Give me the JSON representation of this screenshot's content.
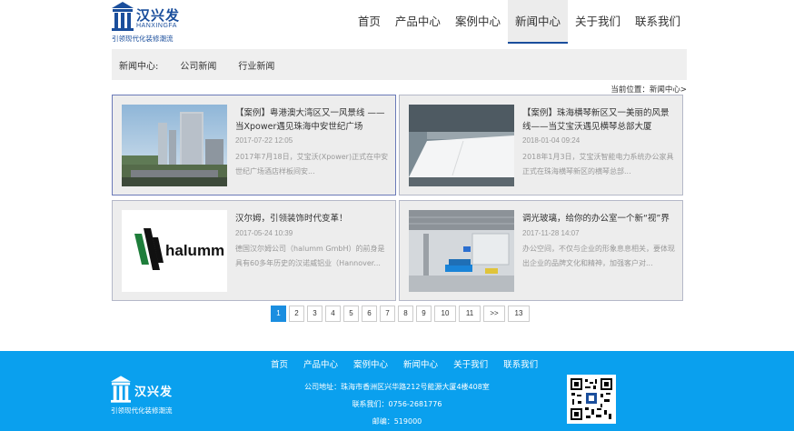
{
  "brand": {
    "name_cn": "汉兴发",
    "name_en": "HANXINGFA",
    "tagline": "引领现代化装修潮流",
    "color": "#1a4e9c"
  },
  "nav": {
    "items": [
      "首页",
      "产品中心",
      "案例中心",
      "新闻中心",
      "关于我们",
      "联系我们"
    ],
    "active": "新闻中心"
  },
  "subbar": {
    "label": "新闻中心:",
    "links": [
      "公司新闻",
      "行业新闻"
    ]
  },
  "breadcrumb": "当前位置：新闻中心>",
  "news": [
    {
      "title": "【案例】粤港澳大湾区又一风景线 ——当Xpower遇见珠海中安世纪广场",
      "date": "2017-07-22 12:05",
      "desc": "2017年7月18日，艾宝沃(Xpower)正式在中安世纪广场酒店样板间安...",
      "image": "building-photo"
    },
    {
      "title": "【案例】珠海横琴新区又一美丽的风景线——当艾宝沃遇见横琴总部大厦",
      "date": "2018-01-04 09:24",
      "desc": "2018年1月3日，艾宝沃智能电力系统办公家具正式在珠海横琴新区的横琴总部...",
      "image": "meeting-table-photo"
    },
    {
      "title": "汉尔姆，引领装饰时代变革！",
      "date": "2017-05-24 10:39",
      "desc": "德国汉尔姆公司（halumm GmbH）的前身是具有60多年历史的汉诺威铝业（Hannover...",
      "image": "halumm-logo",
      "logo_text": "halumm"
    },
    {
      "title": "调光玻璃，给你的办公室一个新“视”界",
      "date": "2017-11-28 14:07",
      "desc": "办公空间，不仅与企业的形象息息相关，要体现出企业的品牌文化和精神，加强客户对...",
      "image": "office-interior-photo"
    }
  ],
  "pagination": {
    "pages": [
      "1",
      "2",
      "3",
      "4",
      "5",
      "6",
      "7",
      "8",
      "9",
      "10",
      "11",
      ">>",
      "13"
    ],
    "current": "1"
  },
  "footer": {
    "nav": [
      "首页",
      "产品中心",
      "案例中心",
      "新闻中心",
      "关于我们",
      "联系我们"
    ],
    "address": "公司地址：珠海市香洲区兴华路212号能源大厦4楼408室",
    "phone": "联系我们：0756-2681776",
    "zip": "邮编：519000",
    "background": "#0aa0ee"
  }
}
